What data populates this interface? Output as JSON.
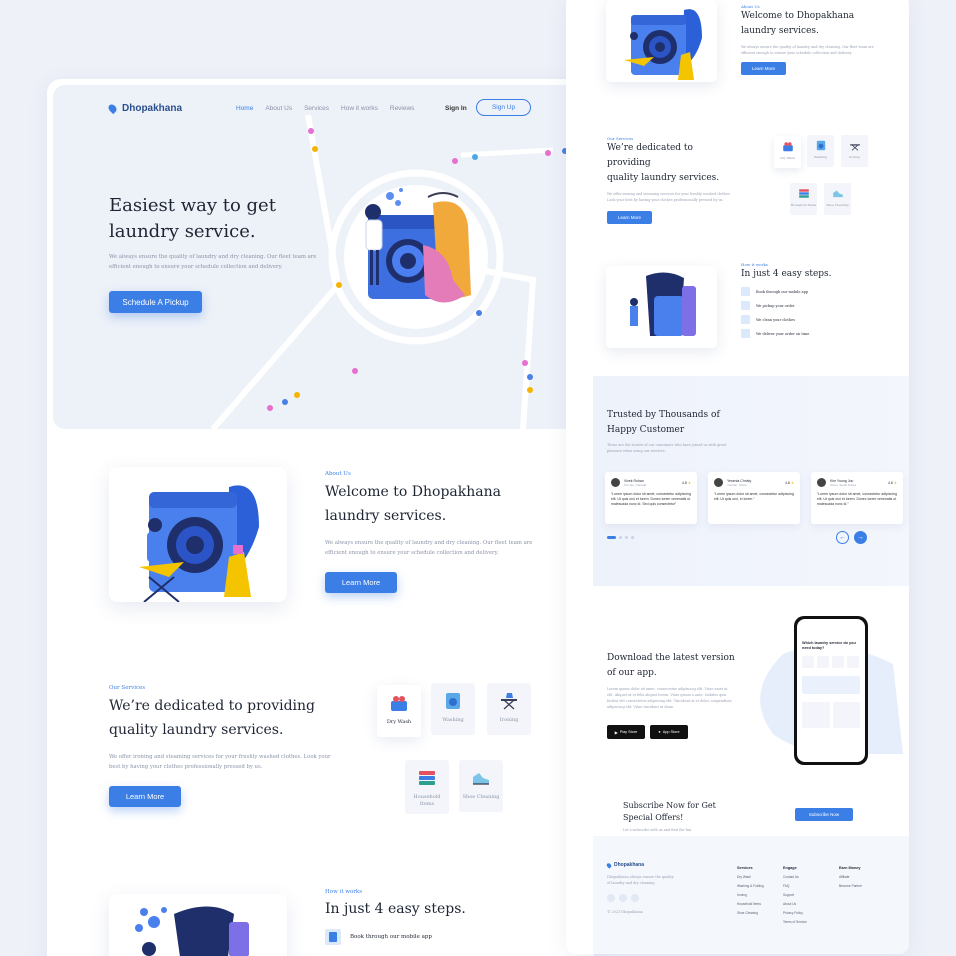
{
  "brand": {
    "name": "Dhopakhana",
    "accent": "#3b7fe6"
  },
  "nav": {
    "links": [
      "Home",
      "About Us",
      "Services",
      "How it works",
      "Reviews"
    ],
    "sign_in": "Sign In",
    "sign_up": "Sign Up"
  },
  "hero": {
    "title_line1": "Easiest way to get",
    "title_line2": "laundry service.",
    "desc": "We always ensure the quality of laundry and dry cleaning. Our fleet team are efficient enough to ensure your schedule collection and delivery.",
    "cta": "Schedule A Pickup"
  },
  "about": {
    "label": "About Us",
    "title_line1": "Welcome to Dhopakhana",
    "title_line2": "laundry services.",
    "desc": "We always ensure the quality of laundry and dry cleaning. Our fleet team are efficient enough to ensure your schedule collection and delivery.",
    "cta": "Learn More"
  },
  "services": {
    "label": "Our Services",
    "title_line1": "We’re dedicated to providing",
    "title_line2": "quality laundry services.",
    "desc": "We offer ironing and steaming services for your freshly washed clothes. Look your best by having your clothes professionally pressed by us.",
    "cta": "Learn More",
    "items": [
      {
        "label": "Dry Wash"
      },
      {
        "label": "Washing"
      },
      {
        "label": "Ironing"
      },
      {
        "label": "Household Items"
      },
      {
        "label": "Shoe Cleaning"
      }
    ]
  },
  "steps": {
    "label": "How it works",
    "title": "In just 4 easy steps.",
    "items": [
      "Book through our mobile app",
      "We pickup your order",
      "We clean your clothes",
      "We deliver your order on time"
    ]
  },
  "testimonials": {
    "title_line1": "Trusted by Thousands of",
    "title_line2": "Happy Customer",
    "desc": "These are the stories of our customers who have joined us with great pleasure when using our services.",
    "cards": [
      {
        "name": "Vivek Rohan",
        "role": "Toronto, Canada",
        "rating": "4.8",
        "text": "“Lorem ipsum dolor sit amet, consectetur adipiscing elit. Ut quis orci et lorem. Donec lorem venenatis ut malesuada nunc id. Sed quis consectetur”"
      },
      {
        "name": "Yesenia Christy",
        "role": "Yunnan, China",
        "rating": "4.8",
        "text": "“Lorem ipsum dolor sit amet, consectetur adipiscing elit. Ut quis orci, in lorem.”"
      },
      {
        "name": "Kim Young Jou",
        "role": "Seoul, South Korea",
        "rating": "4.8",
        "text": "“Lorem ipsum dolor sit amet, consectetur adipiscing elit. Ut quis orci et lorem. Donec lorem venenatis ut malesuada nunc id.”"
      }
    ]
  },
  "app": {
    "title_line1": "Download the latest version",
    "title_line2": "of our app.",
    "desc": "Lorem ipsum dolor sit amet, consectetur adipiscing elit. Vitae amet at elit. Aliquet at et felis aliquet lorem. Vitae ipsum a ante. Sodales quis facilisi elit consectetur adipiscing elit. Tincidunt at et dolor, suspendisse adipiscing elit. Vitae tincidunt at diam.",
    "play_store": "Play Store",
    "app_store": "App Store",
    "phone_heading": "Which laundry service do you need today?"
  },
  "subscribe": {
    "title_line1": "Subscribe Now for Get",
    "title_line2": "Special Offers!",
    "desc": "Let’s subscribe with us and find the fun.",
    "cta": "Subscribe Now"
  },
  "footer": {
    "about": "Dhopakhana always ensure the quality of laundry and dry cleaning.",
    "copyright": "© 2021 Dhopakhana",
    "columns": [
      {
        "heading": "Services",
        "links": [
          "Dry Wash",
          "Washing & Folding",
          "Ironing",
          "Household Items",
          "Shoe Cleaning"
        ]
      },
      {
        "heading": "Engage",
        "links": [
          "Contact Us",
          "FAQ",
          "Support",
          "About Us",
          "Privacy Policy",
          "Terms of Service"
        ]
      },
      {
        "heading": "Earn Money",
        "links": [
          "Affiliate",
          "Become Partner"
        ]
      }
    ]
  }
}
